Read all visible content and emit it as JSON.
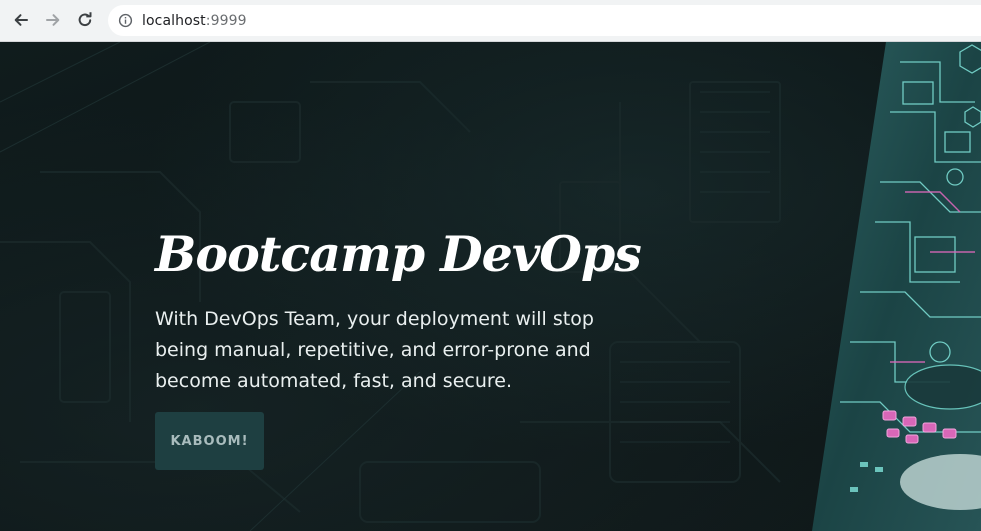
{
  "browser": {
    "url_host": "localhost",
    "url_port": ":9999",
    "icons": {
      "back": "back-arrow-icon",
      "forward": "forward-arrow-icon",
      "reload": "reload-icon",
      "info": "info-icon"
    }
  },
  "hero": {
    "title": "Bootcamp DevOps",
    "description": "With DevOps Team, your deployment will stop being manual, repetitive, and error-prone and become automated, fast, and secure.",
    "cta_label": "KABOOM!"
  },
  "colors": {
    "hero_background": "#0d1415",
    "accent_teal": "#5fd1c7",
    "button_background": "#1e3f41",
    "button_text": "#a9bcbd",
    "highlight_pink": "#d867b8"
  }
}
